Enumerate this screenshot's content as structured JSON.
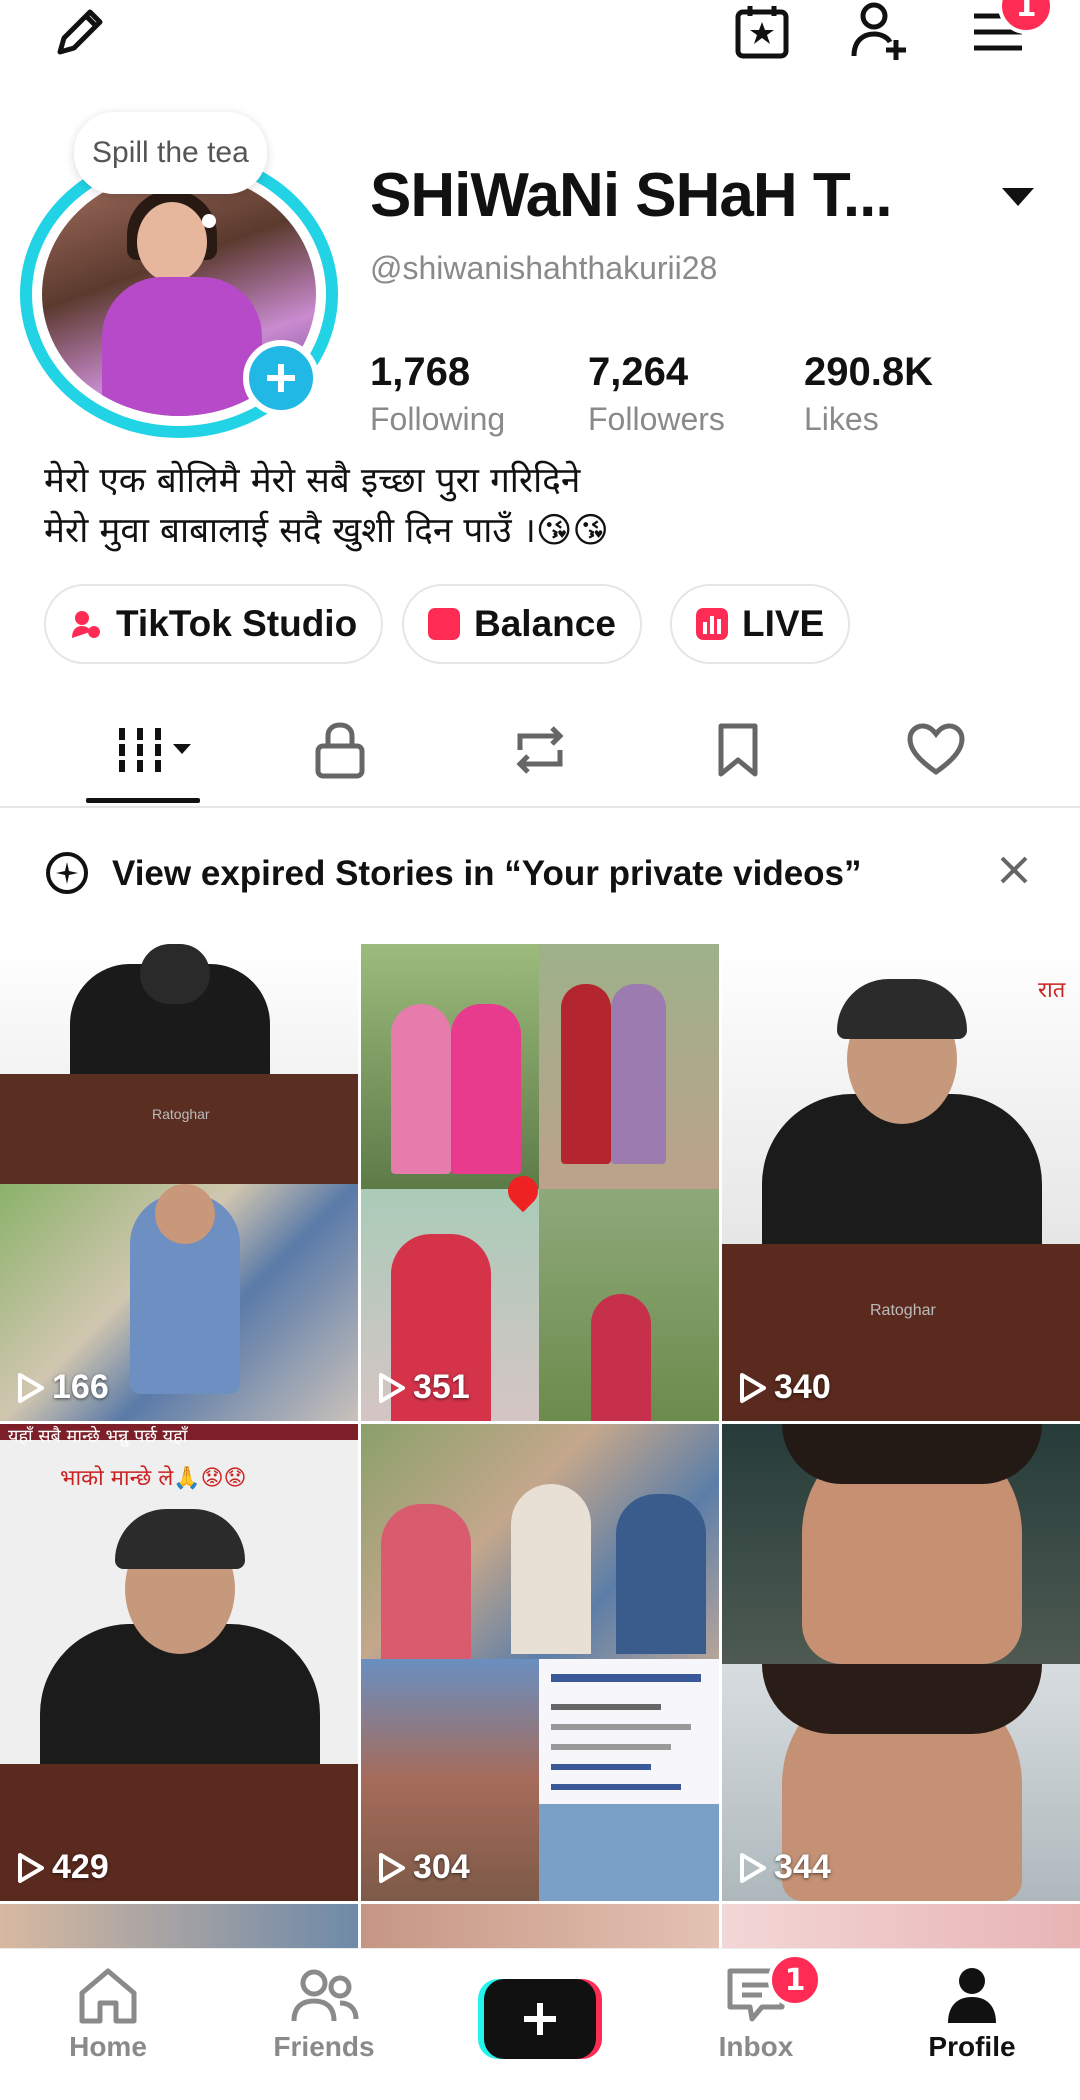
{
  "header": {
    "edit_icon": "pencil-icon",
    "calendar_icon": "calendar-star-icon",
    "add_friend_icon": "add-user-icon",
    "menu_icon": "hamburger-menu-icon",
    "menu_badge": "1"
  },
  "profile": {
    "bubble_text": "Spill the tea",
    "display_name": "SHiWaNi SHaH T...",
    "username": "@shiwanishahthakurii28",
    "stats": [
      {
        "value": "1,768",
        "label": "Following"
      },
      {
        "value": "7,264",
        "label": "Followers"
      },
      {
        "value": "290.8K",
        "label": "Likes"
      }
    ],
    "bio_line1": "मेरो एक बोलिमै मेरो सबै इच्छा पुरा गरिदिने",
    "bio_line2": "मेरो मुवा बाबालाई सदै खुशी दिन पाउँ ।😘😘"
  },
  "chips": [
    {
      "label": "TikTok Studio",
      "color": "#fe2c55"
    },
    {
      "label": "Balance",
      "color": "#fe2c55"
    },
    {
      "label": "LIVE",
      "color": "#fe2c55"
    }
  ],
  "tabs": [
    "videos-grid-icon",
    "lock-icon",
    "repost-icon",
    "bookmark-icon",
    "heart-icon"
  ],
  "notice": {
    "text": "View expired Stories in “Your private videos”"
  },
  "videos": [
    {
      "views": "166"
    },
    {
      "views": "351"
    },
    {
      "views": "340"
    },
    {
      "views": "429"
    },
    {
      "views": "304"
    },
    {
      "views": "344"
    }
  ],
  "tile_text": {
    "t1_label": "Ratoghar",
    "t3_label": "Ratoghar",
    "t3_corner": "रात",
    "t4_banner1": "यहाँ सबै मान्छे भन्नु पर्छ यहाँ",
    "t4_banner2": "भाको मान्छे ले🙏😟😟"
  },
  "nav": {
    "home": "Home",
    "friends": "Friends",
    "inbox": "Inbox",
    "inbox_badge": "1",
    "profile": "Profile"
  },
  "colors": {
    "accent": "#fe2c55",
    "ring": "#22d3e6",
    "secondary_text": "#8a8a8a"
  }
}
